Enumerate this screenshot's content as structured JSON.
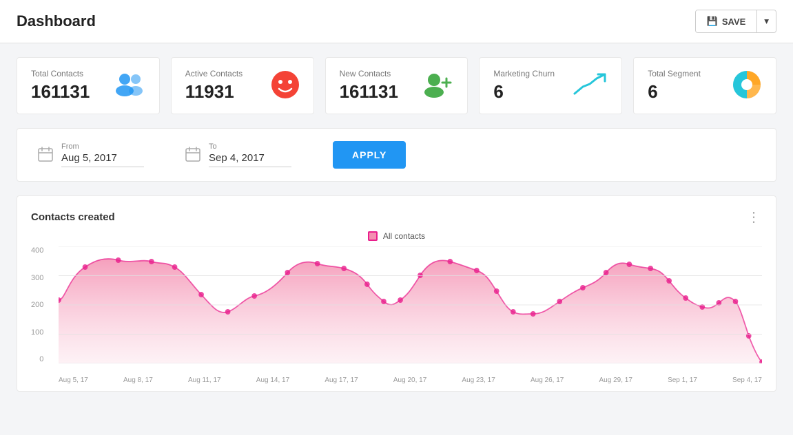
{
  "header": {
    "title": "Dashboard",
    "save_label": "SAVE",
    "save_icon": "💾"
  },
  "kpi_cards": [
    {
      "label": "Total Contacts",
      "value": "161131",
      "icon_name": "people-icon",
      "icon_color": "#2196F3"
    },
    {
      "label": "Active Contacts",
      "value": "11931",
      "icon_name": "face-icon",
      "icon_color": "#f44336"
    },
    {
      "label": "New Contacts",
      "value": "161131",
      "icon_name": "add-person-icon",
      "icon_color": "#4CAF50"
    },
    {
      "label": "Marketing Churn",
      "value": "6",
      "icon_name": "trending-up-icon",
      "icon_color": "#26C6DA"
    },
    {
      "label": "Total Segment",
      "value": "6",
      "icon_name": "pie-chart-icon",
      "icon_color": "#FFA726"
    }
  ],
  "filter": {
    "from_label": "From",
    "from_value": "Aug 5, 2017",
    "to_label": "To",
    "to_value": "Sep 4, 2017",
    "apply_label": "APPLY"
  },
  "chart": {
    "title": "Contacts created",
    "legend_label": "All contacts",
    "y_labels": [
      "400",
      "300",
      "200",
      "100",
      "0"
    ],
    "x_labels": [
      "Aug 5, 17",
      "Aug 8, 17",
      "Aug 11, 17",
      "Aug 14, 17",
      "Aug 17, 17",
      "Aug 20, 17",
      "Aug 23, 17",
      "Aug 26, 17",
      "Aug 29, 17",
      "Sep 1, 17",
      "Sep 4, 17"
    ]
  }
}
